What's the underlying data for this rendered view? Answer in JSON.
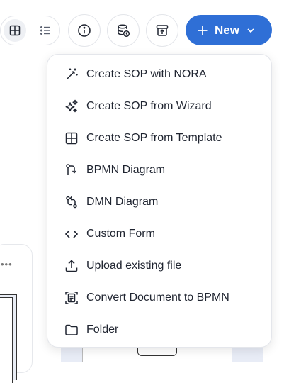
{
  "toolbar": {
    "view_toggle": {
      "grid_icon": "grid-icon",
      "list_icon": "list-icon",
      "active": "grid"
    },
    "buttons": [
      {
        "icon": "info-icon"
      },
      {
        "icon": "database-history-icon"
      },
      {
        "icon": "archive-upload-icon"
      }
    ],
    "new_button": {
      "label": "New",
      "icon": "plus-icon",
      "caret": "chevron-down-icon"
    },
    "accent_color": "#2f6fd6"
  },
  "menu": {
    "items": [
      {
        "label": "Create SOP with NORA",
        "icon": "magic-wand-icon"
      },
      {
        "label": "Create SOP from Wizard",
        "icon": "sparkles-icon"
      },
      {
        "label": "Create SOP from Template",
        "icon": "template-grid-icon"
      },
      {
        "label": "BPMN Diagram",
        "icon": "bpmn-flow-icon"
      },
      {
        "label": "DMN Diagram",
        "icon": "dmn-flow-icon"
      },
      {
        "label": "Custom Form",
        "icon": "code-brackets-icon"
      },
      {
        "label": "Upload existing file",
        "icon": "upload-icon"
      },
      {
        "label": "Convert Document to BPMN",
        "icon": "convert-document-icon"
      },
      {
        "label": "Folder",
        "icon": "folder-icon"
      }
    ]
  },
  "background": {
    "card_more": "•••"
  }
}
